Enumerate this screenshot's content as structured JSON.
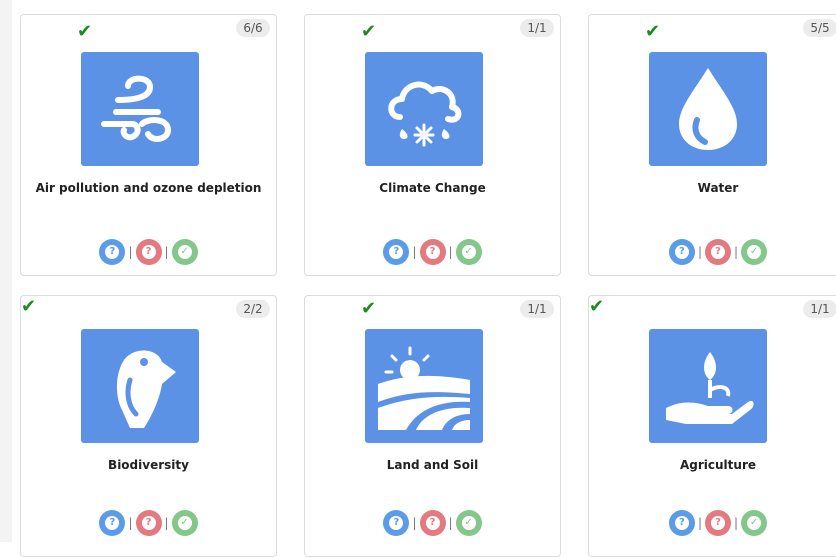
{
  "cards": [
    {
      "title": "Air pollution and ozone depletion",
      "count": "6/6",
      "icon": "wind-icon",
      "check": "✔"
    },
    {
      "title": "Climate Change",
      "count": "1/1",
      "icon": "cloud-snow-rain-icon",
      "check": "✔"
    },
    {
      "title": "Water",
      "count": "5/5",
      "icon": "water-drop-icon",
      "check": "✔"
    },
    {
      "title": "Biodiversity",
      "count": "2/2",
      "icon": "puffin-bird-icon",
      "check": "✔"
    },
    {
      "title": "Land and Soil",
      "count": "1/1",
      "icon": "sun-field-icon",
      "check": "✔"
    },
    {
      "title": "Agriculture",
      "count": "1/1",
      "icon": "hand-sprout-icon",
      "check": "✔"
    }
  ],
  "buttons": {
    "help": "?",
    "wrong": "?",
    "correct": "✓",
    "separator": "|"
  },
  "colors": {
    "accent": "#5b92e5",
    "help": "#5b9be8",
    "wrong": "#e27a80",
    "correct": "#84c78b",
    "check": "#1f8a1f"
  }
}
